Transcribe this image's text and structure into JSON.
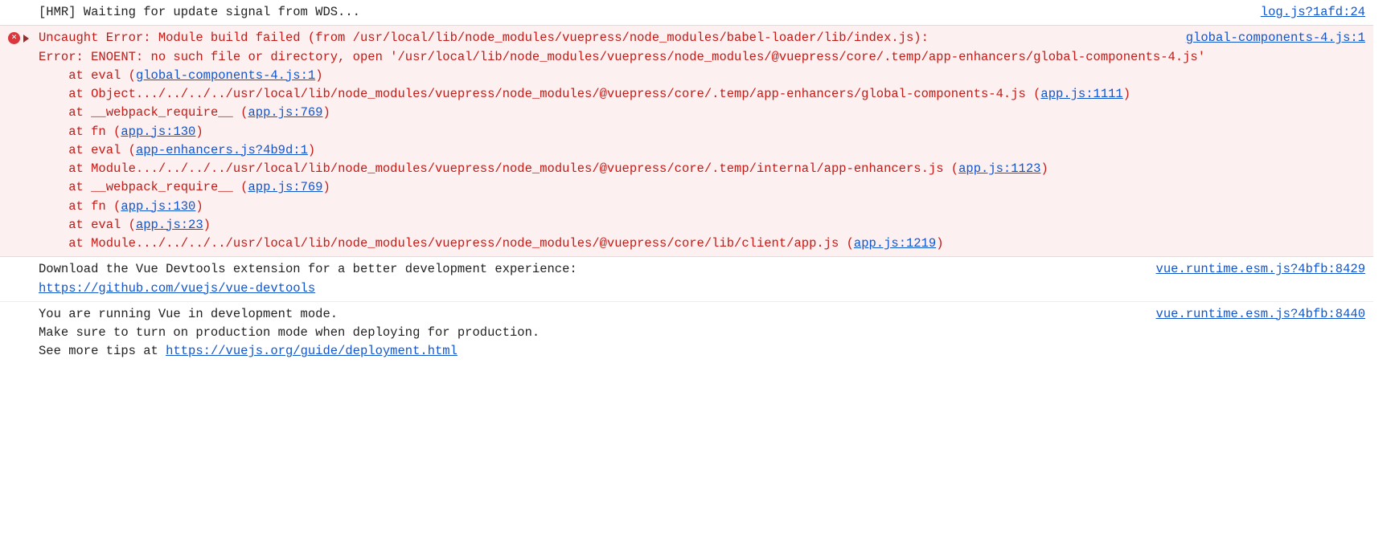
{
  "entries": [
    {
      "kind": "log",
      "source": "log.js?1afd:24",
      "body_plain": "[HMR] Waiting for update signal from WDS..."
    },
    {
      "kind": "error",
      "source": "global-components-4.js:1",
      "head_pre": "Uncaught Error: Module build failed (from /usr/local/lib/node_modules/vuepress/node_modules/babel-loader/lib/index.js):",
      "head_mid": "Error: ENOENT: no such file or directory, open '/usr/local/lib/node_modules/vuepress/node_modules/@vuepress/core/.temp/app-enhancers/global-components-4.js'",
      "frames": [
        {
          "pre": "at eval (",
          "link": "global-components-4.js:1",
          "post": ")"
        },
        {
          "pre": "at Object.../../../../usr/local/lib/node_modules/vuepress/node_modules/@vuepress/core/.temp/app-enhancers/global-components-4.js (",
          "link": "app.js:1111",
          "post": ")"
        },
        {
          "pre": "at __webpack_require__ (",
          "link": "app.js:769",
          "post": ")"
        },
        {
          "pre": "at fn (",
          "link": "app.js:130",
          "post": ")"
        },
        {
          "pre": "at eval (",
          "link": "app-enhancers.js?4b9d:1",
          "post": ")"
        },
        {
          "pre": "at Module.../../../../usr/local/lib/node_modules/vuepress/node_modules/@vuepress/core/.temp/internal/app-enhancers.js (",
          "link": "app.js:1123",
          "post": ")"
        },
        {
          "pre": "at __webpack_require__ (",
          "link": "app.js:769",
          "post": ")"
        },
        {
          "pre": "at fn (",
          "link": "app.js:130",
          "post": ")"
        },
        {
          "pre": "at eval (",
          "link": "app.js:23",
          "post": ")"
        },
        {
          "pre": "at Module.../../../../usr/local/lib/node_modules/vuepress/node_modules/@vuepress/core/lib/client/app.js (",
          "link": "app.js:1219",
          "post": ")"
        }
      ]
    },
    {
      "kind": "log",
      "source": "vue.runtime.esm.js?4bfb:8429",
      "body_pre": "Download the Vue Devtools extension for a better development experience:",
      "body_link": "https://github.com/vuejs/vue-devtools"
    },
    {
      "kind": "log",
      "source": "vue.runtime.esm.js?4bfb:8440",
      "body_pre": "You are running Vue in development mode.",
      "body_mid": "Make sure to turn on production mode when deploying for production.",
      "body_post_pre": "See more tips at ",
      "body_link": "https://vuejs.org/guide/deployment.html"
    }
  ]
}
